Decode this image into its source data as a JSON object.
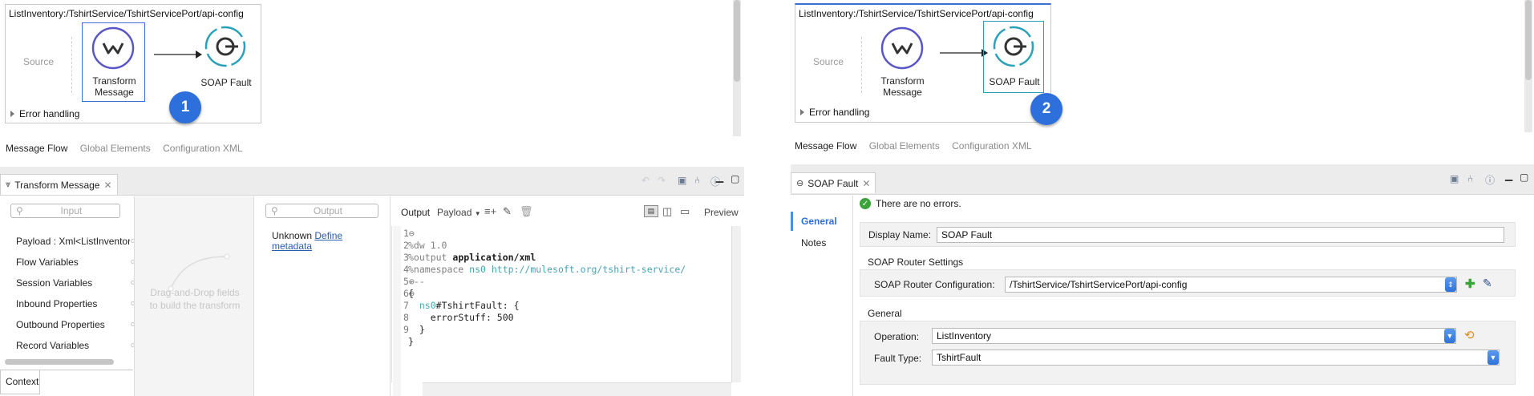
{
  "left": {
    "flow_title": "ListInventory:/TshirtService/TshirtServicePort/api-config",
    "source_label": "Source",
    "transform_label_1": "Transform",
    "transform_label_2": "Message",
    "soap_fault_label": "SOAP Fault",
    "error_handling": "Error handling",
    "badge": "1",
    "tabs": [
      "Message Flow",
      "Global Elements",
      "Configuration XML"
    ],
    "panel_tab": "Transform Message",
    "input_placeholder": "Input",
    "output_placeholder": "Output",
    "context_items": [
      "Payload : Xml<ListInventor",
      "Flow Variables",
      "Session Variables",
      "Inbound Properties",
      "Outbound Properties",
      "Record Variables"
    ],
    "dnd_hint_1": "Drag-and-Drop fields",
    "dnd_hint_2": "to build the transform",
    "unknown": "Unknown",
    "define_metadata_1": "Define",
    "define_metadata_2": "metadata",
    "output_label": "Output",
    "payload_label": "Payload",
    "preview_label": "Preview",
    "context_tab": "Context",
    "code": {
      "l1": "%dw 1.0",
      "l2a": "%output ",
      "l2b": "application/xml",
      "l3a": "%namespace ",
      "l3b": "ns0 ",
      "l3c": "http://mulesoft.org/tshirt-service/",
      "l4": "---",
      "l5": "{",
      "l6a": "ns0",
      "l6b": "#TshirtFault: {",
      "l7": "errorStuff: 500",
      "l8": "}",
      "l9": "}"
    }
  },
  "right": {
    "flow_title": "ListInventory:/TshirtService/TshirtServicePort/api-config",
    "source_label": "Source",
    "transform_label_1": "Transform",
    "transform_label_2": "Message",
    "soap_fault_label": "SOAP Fault",
    "error_handling": "Error handling",
    "badge": "2",
    "tabs": [
      "Message Flow",
      "Global Elements",
      "Configuration XML"
    ],
    "panel_tab": "SOAP Fault",
    "nav": [
      "General",
      "Notes"
    ],
    "no_errors": "There are no errors.",
    "display_name_label": "Display Name:",
    "display_name_value": "SOAP Fault",
    "router_section": "SOAP Router Settings",
    "router_config_label": "SOAP Router Configuration:",
    "router_config_value": "/TshirtService/TshirtServicePort/api-config",
    "general_section": "General",
    "operation_label": "Operation:",
    "operation_value": "ListInventory",
    "fault_type_label": "Fault Type:",
    "fault_type_value": "TshirtFault"
  },
  "colors": {
    "accent": "#2d6fdb",
    "link": "#2a5db0",
    "teal": "#2aa1b8",
    "purple": "#5a56c7"
  }
}
